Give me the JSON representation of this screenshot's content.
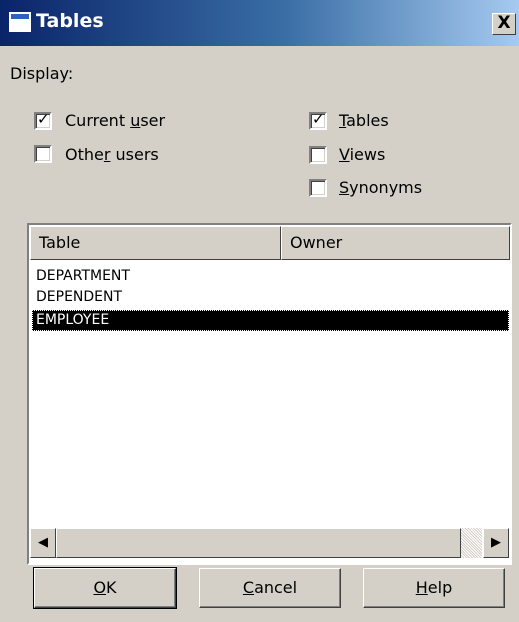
{
  "window": {
    "title": "Tables",
    "close_glyph": "X"
  },
  "display_label": "Display:",
  "checkboxes": {
    "current_user": {
      "pre": "Current ",
      "accel": "u",
      "post": "ser",
      "checked": true
    },
    "other_users": {
      "pre": "Othe",
      "accel": "r",
      "post": " users",
      "checked": false
    },
    "tables": {
      "pre": "",
      "accel": "T",
      "post": "ables",
      "checked": true
    },
    "views": {
      "pre": "",
      "accel": "V",
      "post": "iews",
      "checked": false
    },
    "synonyms": {
      "pre": "",
      "accel": "S",
      "post": "ynonyms",
      "checked": false
    }
  },
  "list": {
    "columns": [
      "Table",
      "Owner"
    ],
    "rows": [
      {
        "table": "DEPARTMENT",
        "owner": "",
        "selected": false
      },
      {
        "table": "DEPENDENT",
        "owner": "",
        "selected": false
      },
      {
        "table": "EMPLOYEE",
        "owner": "",
        "selected": true
      }
    ],
    "scroll_left_glyph": "◀",
    "scroll_right_glyph": "▶"
  },
  "buttons": {
    "ok": {
      "pre": "",
      "accel": "O",
      "post": "K"
    },
    "cancel": {
      "pre": "",
      "accel": "C",
      "post": "ancel"
    },
    "help": {
      "pre": "",
      "accel": "H",
      "post": "elp"
    }
  },
  "check_glyph": "✓",
  "icons": {
    "title_icon": "window-icon",
    "close": "close-icon",
    "scroll_left": "arrow-left-icon",
    "scroll_right": "arrow-right-icon"
  },
  "colors": {
    "titlebar_start": "#0a246a",
    "titlebar_end": "#a6caf0",
    "face": "#d4d0c8",
    "selection": "#000000"
  }
}
